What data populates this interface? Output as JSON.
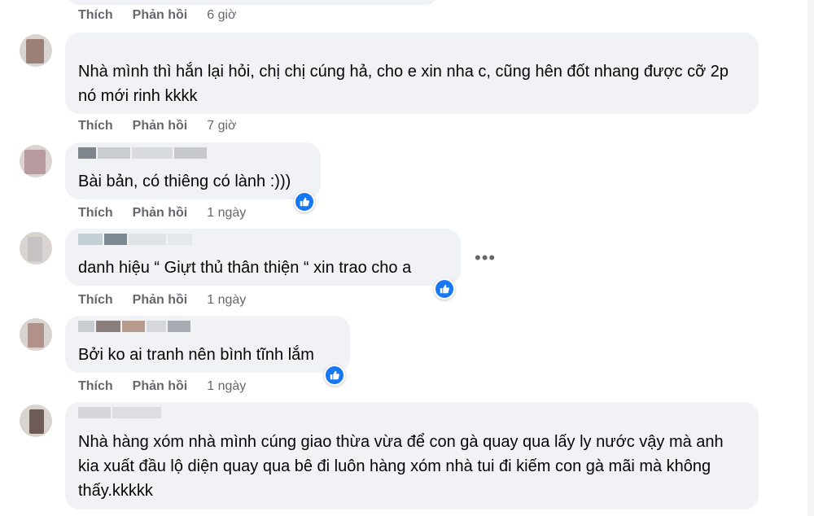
{
  "comments": [
    {
      "text": "",
      "like_label": "Thích",
      "reply_label": "Phản hồi",
      "time": "6 giờ"
    },
    {
      "text": "Nhà mình thì hắn lại hỏi, chị chị cúng hả, cho e xin nha c, cũng hên đốt nhang được cỡ 2p nó mới rinh kkkk",
      "like_label": "Thích",
      "reply_label": "Phản hồi",
      "time": "7 giờ"
    },
    {
      "text": "Bài bản, có thiêng có lành :)))",
      "like_label": "Thích",
      "reply_label": "Phản hồi",
      "time": "1 ngày",
      "reaction": "like-icon"
    },
    {
      "text": "danh hiệu “ Giựt thủ thân thiện “ xin trao cho a",
      "like_label": "Thích",
      "reply_label": "Phản hồi",
      "time": "1 ngày",
      "reaction": "like-icon",
      "more": "•••"
    },
    {
      "text": "Bởi ko ai tranh nên bình tĩnh lắm",
      "like_label": "Thích",
      "reply_label": "Phản hồi",
      "time": "1 ngày",
      "reaction": "like-icon"
    },
    {
      "text": "Nhà hàng xóm nhà mình cúng giao thừa vừa để con gà quay qua lấy ly nước vậy mà anh kia xuất đầu lộ diện quay qua bê đi luôn hàng xóm nhà tui đi kiếm con gà mãi mà không thấy.kkkkk"
    }
  ],
  "colors": {
    "bubble": "#f0f2f5",
    "text": "#050505",
    "meta": "#65676b",
    "like_blue": "#1877f2"
  }
}
